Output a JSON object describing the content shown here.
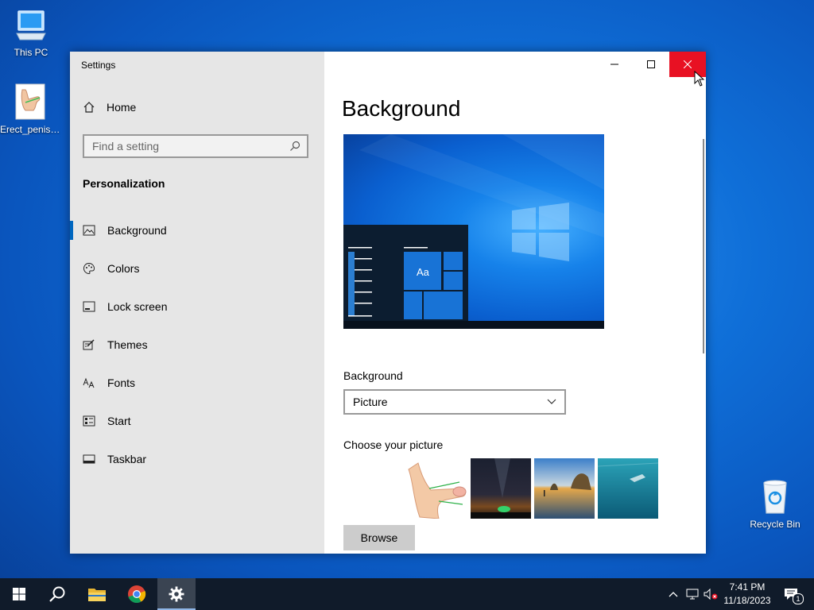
{
  "desktop": {
    "icons": [
      {
        "label": "This PC",
        "icon": "computer-icon"
      },
      {
        "label": "Erect_penis_...",
        "icon": "image-file-icon"
      },
      {
        "label": "Recycle Bin",
        "icon": "recycle-bin-icon"
      }
    ]
  },
  "window": {
    "title": "Settings",
    "controls": {
      "minimize": "minimize-icon",
      "maximize": "maximize-icon",
      "close": "close-icon"
    }
  },
  "sidebar": {
    "home_label": "Home",
    "search_placeholder": "Find a setting",
    "section_title": "Personalization",
    "items": [
      {
        "label": "Background",
        "icon": "picture-icon",
        "active": true
      },
      {
        "label": "Colors",
        "icon": "palette-icon",
        "active": false
      },
      {
        "label": "Lock screen",
        "icon": "lock-screen-icon",
        "active": false
      },
      {
        "label": "Themes",
        "icon": "themes-icon",
        "active": false
      },
      {
        "label": "Fonts",
        "icon": "fonts-icon",
        "active": false
      },
      {
        "label": "Start",
        "icon": "start-icon",
        "active": false
      },
      {
        "label": "Taskbar",
        "icon": "taskbar-icon",
        "active": false
      }
    ]
  },
  "main": {
    "title": "Background",
    "preview_tile_text": "Aa",
    "background_label": "Background",
    "background_value": "Picture",
    "choose_label": "Choose your picture",
    "browse_label": "Browse"
  },
  "taskbar": {
    "time": "7:41 PM",
    "date": "11/18/2023",
    "notification_count": "1"
  },
  "colors": {
    "accent": "#0067c0",
    "close_red": "#e81123",
    "sidebar_bg": "#e6e6e6",
    "taskbar_bg": "#101b2a"
  }
}
